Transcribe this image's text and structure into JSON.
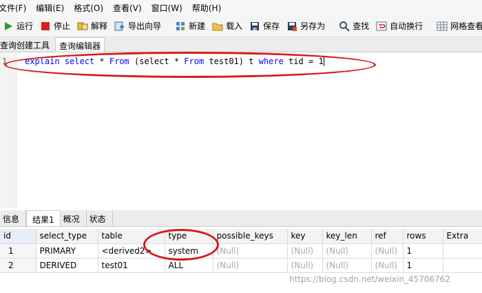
{
  "menu": [
    {
      "label": "文件(F)"
    },
    {
      "label": "编辑(E)"
    },
    {
      "label": "格式(O)"
    },
    {
      "label": "查看(V)"
    },
    {
      "label": "窗口(W)"
    },
    {
      "label": "帮助(H)"
    }
  ],
  "toolbar": {
    "run": "运行",
    "stop": "停止",
    "explain": "解释",
    "export_wizard": "导出向导",
    "new": "新建",
    "load": "载入",
    "save": "保存",
    "save_as": "另存为",
    "find": "查找",
    "auto_wrap": "自动换行",
    "grid_view": "网格查看"
  },
  "editor_tabs": {
    "builder": "查询创建工具",
    "editor": "查询编辑器"
  },
  "editor": {
    "line_number": "1",
    "tokens": {
      "t1": "explain",
      "t2": "select",
      "t3": "*",
      "t4": "From",
      "t5": "(select",
      "t6": "*",
      "t7": "From",
      "t8": "test01)",
      "t9": "t",
      "t10": "where",
      "t11": "tid",
      "t12": "=",
      "t13": "1"
    }
  },
  "result_tabs": {
    "info": "信息",
    "result1": "结果1",
    "overview": "概况",
    "status": "状态"
  },
  "table": {
    "columns": [
      "id",
      "select_type",
      "table",
      "type",
      "possible_keys",
      "key",
      "key_len",
      "ref",
      "rows",
      "Extra"
    ],
    "rows": [
      [
        "1",
        "PRIMARY",
        "<derived2>",
        "system",
        "(Null)",
        "(Null)",
        "(Null)",
        "(Null)",
        "1",
        ""
      ],
      [
        "2",
        "DERIVED",
        "test01",
        "ALL",
        "(Null)",
        "(Null)",
        "(Null)",
        "(Null)",
        "1",
        ""
      ]
    ]
  },
  "watermark": "https://blog.csdn.net/weixin_45706762",
  "colors": {
    "annotation": "#d41b1b",
    "keyword": "#0000ff",
    "null_text": "#a8a8a8"
  }
}
